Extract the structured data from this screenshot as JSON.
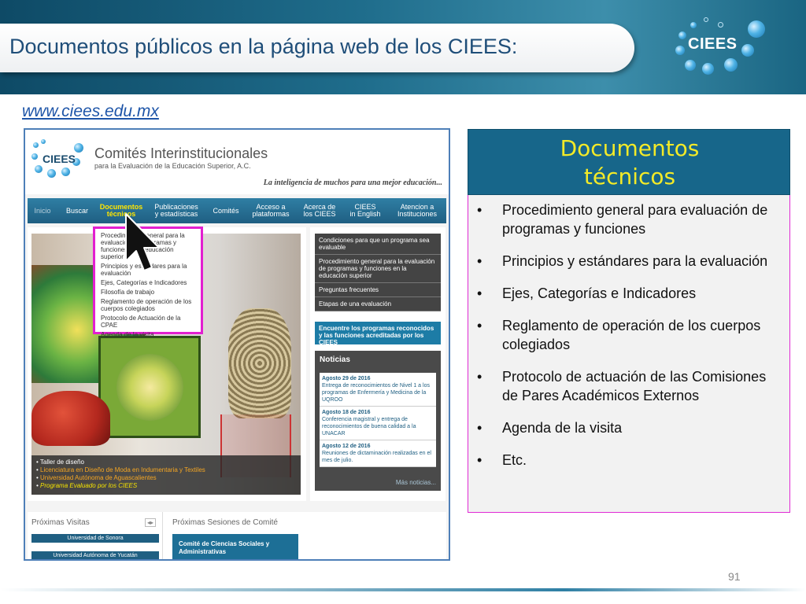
{
  "slide": {
    "title": "Documentos públicos en la página web de los CIEES:",
    "logo_text": "CIEES",
    "url": "www.ciees.edu.mx",
    "page_number": "91"
  },
  "website": {
    "logo_text": "CIEES",
    "name_line1": "Comités Interinstitucionales",
    "name_line2": "para la Evaluación de la Educación Superior, A.C.",
    "slogan": "La inteligencia de muchos para una mejor educación...",
    "nav": [
      {
        "label": "Inicio"
      },
      {
        "label": "Buscar"
      },
      {
        "label": "Documentos\ntécnicos"
      },
      {
        "label": "Publicaciones\ny estadísticas"
      },
      {
        "label": "Comités"
      },
      {
        "label": "Acceso a\nplataformas"
      },
      {
        "label": "Acerca de\nlos CIEES"
      },
      {
        "label": "CIEES\nin English"
      },
      {
        "label": "Atencion a\nInstituciones"
      }
    ],
    "dropdown": [
      {
        "label": "Procedimiento general para la evaluación de programas y funciones de la educación superior"
      },
      {
        "label": "Principios y estándares para la evaluación"
      },
      {
        "label": "Ejes, Categorías e Indicadores"
      },
      {
        "label": "Filosofía de trabajo"
      },
      {
        "label": "Reglamento de operación de los cuerpos colegiados"
      },
      {
        "label": "Protocolo de Actuación de la CPAE"
      },
      {
        "label": "Agenda de la visita"
      }
    ],
    "hero_captions": [
      {
        "text": "Taller de diseño",
        "color": "#ffffff"
      },
      {
        "text": "Licenciatura en Diseño de Moda en Indumentaria y Textiles",
        "color": "#f5a623"
      },
      {
        "text": "Universidad Autónoma de Aguascalientes",
        "color": "#f5a623"
      },
      {
        "text": "Programa Evaluado por los CIEES",
        "color": "#f5e300"
      }
    ],
    "side_menu": [
      {
        "label": "Condiciones para que un programa sea evaluable"
      },
      {
        "label": "Procedimiento general para la evaluación de programas y funciones en la educación superior"
      },
      {
        "label": "Preguntas frecuentes"
      },
      {
        "label": "Etapas de una evaluación"
      }
    ],
    "side_cta": "Encuentre los programas reconocidos y las funciones acreditadas por los CIEES",
    "news": {
      "title": "Noticias",
      "items": [
        {
          "date": "Agosto 29 de 2016",
          "text": "Entrega de reconocimientos de Nivel 1 a los programas de Enfermería y Medicina de la UQROO"
        },
        {
          "date": "Agosto 18 de 2016",
          "text": "Conferencia magistral y entrega de reconocimientos de buena calidad a la UNACAR"
        },
        {
          "date": "Agosto 12 de 2016",
          "text": "Reuniones de dictaminación realizadas en el mes de julio."
        }
      ],
      "more": "Más noticias..."
    },
    "visits": {
      "title": "Próximas Visitas",
      "items": [
        {
          "label": "Universidad de Sonora"
        },
        {
          "label": "Universidad Autónoma de Yucatán"
        }
      ]
    },
    "sessions": {
      "title": "Próximas Sesiones de Comité",
      "items": [
        {
          "label": "Comité de Ciencias Sociales y Administrativas"
        }
      ]
    }
  },
  "panel": {
    "title": "Documentos\ntécnicos",
    "items": [
      {
        "text": "Procedimiento general para evaluación de programas y funciones"
      },
      {
        "text": "Principios y estándares para la evaluación"
      },
      {
        "text": "Ejes, Categorías e Indicadores"
      },
      {
        "text": "Reglamento de operación de los cuerpos colegiados"
      },
      {
        "text": "Protocolo de actuación de las Comisiones de Pares Académicos Externos"
      },
      {
        "text": "Agenda de la visita"
      },
      {
        "text": "Etc."
      }
    ]
  },
  "colors": {
    "header_bg": "#1f6d8c",
    "title_text": "#1f4e79",
    "panel_head_bg": "#17668a",
    "panel_title": "#f3ea28",
    "highlight_border": "#e21fd0",
    "link": "#1e55a8"
  },
  "icons": {
    "cursor": "arrow-cursor-icon",
    "logo": "bubbles-logo-icon",
    "pager": "pager-arrows-icon"
  }
}
